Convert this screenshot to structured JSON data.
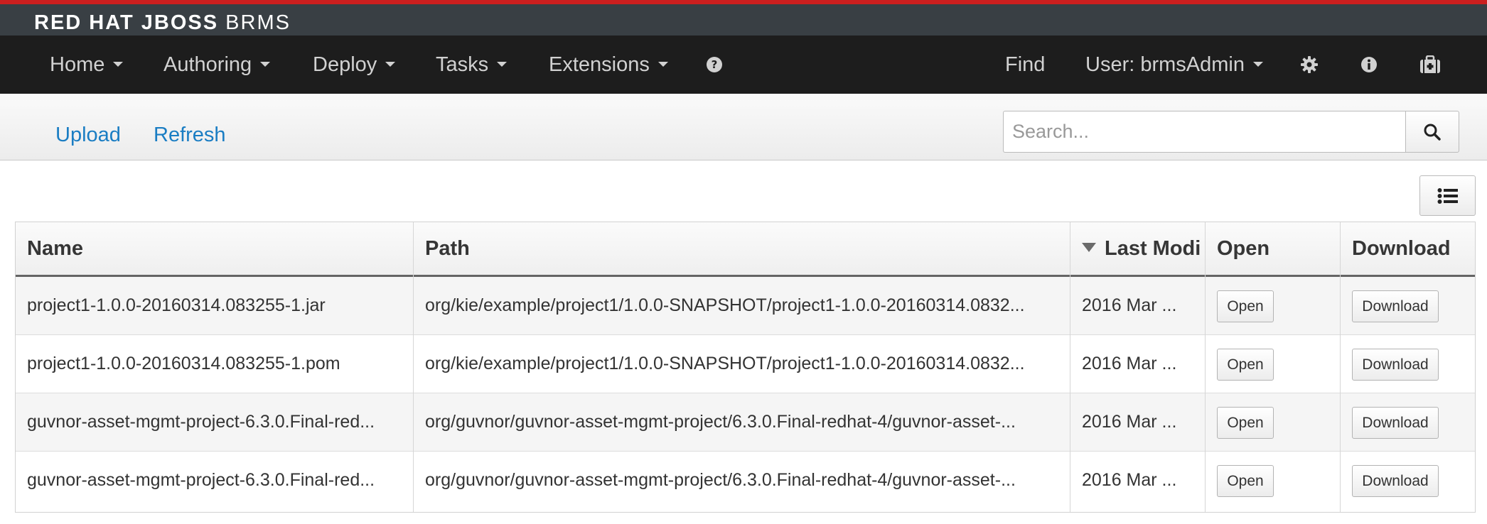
{
  "brand": {
    "bold": "RED HAT JBOSS",
    "light": "BRMS"
  },
  "nav": {
    "home": "Home",
    "authoring": "Authoring",
    "deploy": "Deploy",
    "tasks": "Tasks",
    "extensions": "Extensions",
    "find": "Find",
    "user": "User: brmsAdmin"
  },
  "toolbar": {
    "upload": "Upload",
    "refresh": "Refresh",
    "search_placeholder": "Search..."
  },
  "table": {
    "headers": {
      "name": "Name",
      "path": "Path",
      "last_modified": "Last Modi",
      "open": "Open",
      "download": "Download"
    },
    "rows": [
      {
        "name": "project1-1.0.0-20160314.083255-1.jar",
        "path": "org/kie/example/project1/1.0.0-SNAPSHOT/project1-1.0.0-20160314.0832...",
        "modified": "2016 Mar ...",
        "open": "Open",
        "download": "Download"
      },
      {
        "name": "project1-1.0.0-20160314.083255-1.pom",
        "path": "org/kie/example/project1/1.0.0-SNAPSHOT/project1-1.0.0-20160314.0832...",
        "modified": "2016 Mar ...",
        "open": "Open",
        "download": "Download"
      },
      {
        "name": "guvnor-asset-mgmt-project-6.3.0.Final-red...",
        "path": "org/guvnor/guvnor-asset-mgmt-project/6.3.0.Final-redhat-4/guvnor-asset-...",
        "modified": "2016 Mar ...",
        "open": "Open",
        "download": "Download"
      },
      {
        "name": "guvnor-asset-mgmt-project-6.3.0.Final-red...",
        "path": "org/guvnor/guvnor-asset-mgmt-project/6.3.0.Final-redhat-4/guvnor-asset-...",
        "modified": "2016 Mar ...",
        "open": "Open",
        "download": "Download"
      }
    ]
  }
}
